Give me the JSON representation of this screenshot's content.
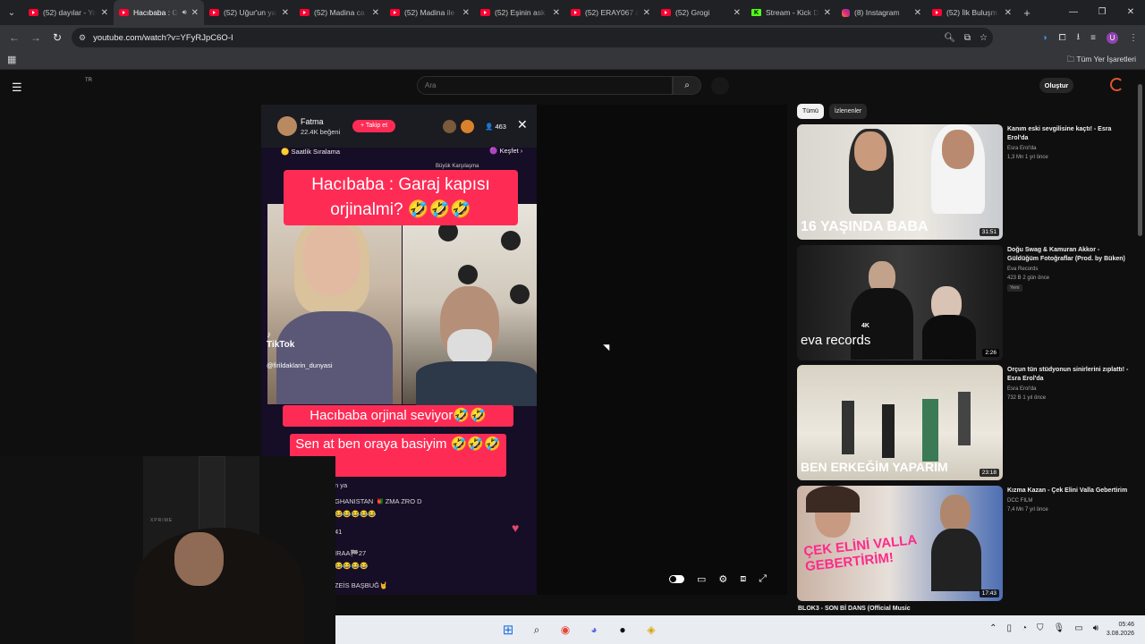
{
  "browser": {
    "tabs": [
      {
        "title": "(52) dayılar - Yo",
        "icon": "youtube",
        "active": false
      },
      {
        "title": "Hacıbaba : G",
        "icon": "youtube",
        "active": true
      },
      {
        "title": "(52) Uğur'un yal",
        "icon": "youtube",
        "active": false
      },
      {
        "title": "(52) Madina ca",
        "icon": "youtube",
        "active": false
      },
      {
        "title": "(52) Madina ile",
        "icon": "youtube",
        "active": false
      },
      {
        "title": "(52) Eşinin ask",
        "icon": "youtube",
        "active": false
      },
      {
        "title": "(52) ERAY067 &",
        "icon": "youtube",
        "active": false
      },
      {
        "title": "(52) Grogi",
        "icon": "youtube",
        "active": false
      },
      {
        "title": "Stream - Kick D",
        "icon": "kick",
        "active": false
      },
      {
        "title": "(8) Instagram",
        "icon": "instagram",
        "active": false
      },
      {
        "title": "(52) İlk Buluşm",
        "icon": "youtube",
        "active": false
      }
    ],
    "url": "youtube.com/watch?v=YFyRJpC6O-I",
    "bookmarks_label": "Tüm Yer İşaretleri",
    "profile_initial": "U"
  },
  "youtube": {
    "country": "TR",
    "search_placeholder": "Ara",
    "create_label": "Oluştur",
    "chips": [
      "Tümü",
      "İzlenenler"
    ],
    "recommendations": [
      {
        "title": "Kanım eski sevgilisine kaçtı! - Esra Erol'da",
        "channel": "Esra Erol'da",
        "meta": "1,3 Mn  1 yıl önce",
        "duration": "31:51",
        "thumb_text": "16 YAŞINDA BABA",
        "badge": ""
      },
      {
        "title": "Doğu Swag & Kamuran Akkor - Güldüğüm Fotoğraflar (Prod. by Büken)",
        "channel": "Eva Records",
        "meta": "423 B  2 gün önce",
        "duration": "2:26",
        "thumb_text": "eva records",
        "badge": "Yeni",
        "quality": "4K"
      },
      {
        "title": "Orçun tün stüdyonun sinirlerini zıplattı! - Esra Erol'da",
        "channel": "Esra Erol'da",
        "meta": "732 B  1 yıl önce",
        "duration": "23:18",
        "thumb_text": "BEN ERKEĞİM YAPARIM",
        "badge": ""
      },
      {
        "title": "Kızma Kazan - Çek Elini Valla Gebertirim",
        "channel": "DCC FILM",
        "meta": "7,4 Mn  7 yıl önce",
        "duration": "17:43",
        "thumb_text": "ÇEK ELİNİ VALLA GEBERTİRİM!",
        "badge": ""
      }
    ],
    "next_title": "BLOK3 - SON Bİ DANS (Official Music"
  },
  "video": {
    "streamer_name": "Fatma",
    "streamer_likes": "22.4K beğeni",
    "follow_label": "+ Takip et",
    "viewer_count": "463",
    "hourly_rank": "Saatlik Sıralama",
    "explore": "Keşfet",
    "big_match": "Büyük Karşılaşma",
    "caption_top": "Hacıbaba : Garaj kapısı orjinalmi? 🤣🤣🤣",
    "caption_mid": "Hacıbaba orjinal seviyor🤣🤣",
    "caption_bottom": "Sen at ben oraya basiyim 🤣🤣🤣",
    "tiktok_label": "TikTok",
    "tiktok_user": "@firildaklarin_dunyasi",
    "chat": [
      "n ya",
      "GHANISTAN  🇦🇫  ZMA ZRO D",
      "😂😂😂😂😂",
      "41",
      "IRAA🏁27",
      "😂😂😂😂",
      "ZEİS BAŞBUĞ🤘"
    ]
  },
  "webcam": {
    "brand": "XPRIME"
  },
  "taskbar": {
    "time": "05:46",
    "date": "3.08.2026"
  }
}
